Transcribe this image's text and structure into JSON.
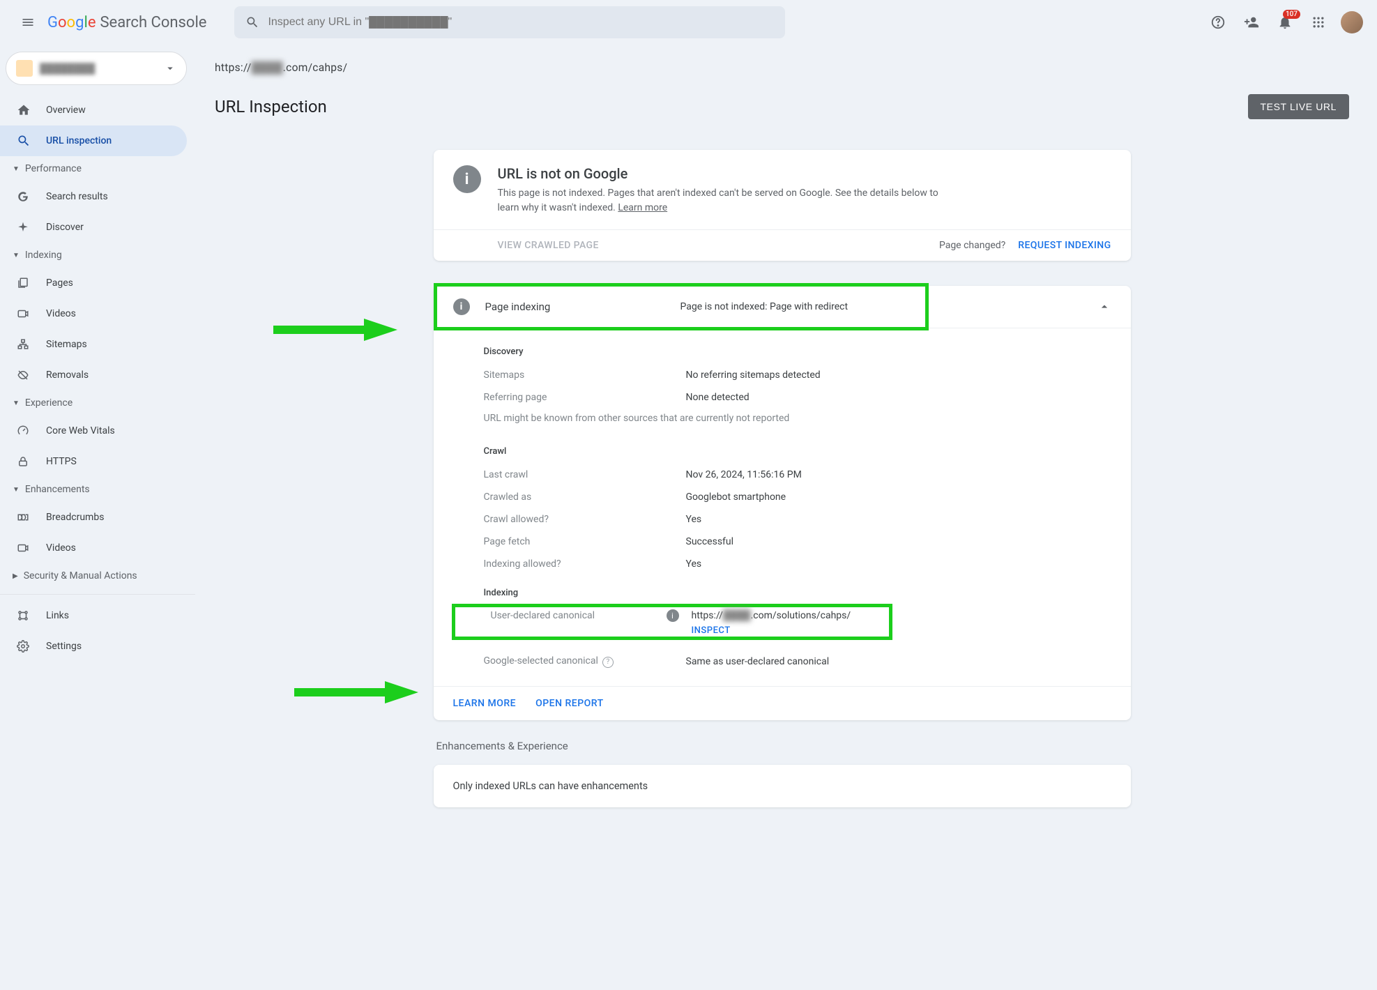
{
  "brand": {
    "suffix": "Search Console"
  },
  "search": {
    "placeholder": "Inspect any URL in \"██████████\""
  },
  "header": {
    "badge": "107"
  },
  "sidebar": {
    "property": "████████",
    "items": {
      "overview": "Overview",
      "url_inspection": "URL inspection"
    },
    "sections": {
      "performance": {
        "label": "Performance",
        "items": {
          "search_results": "Search results",
          "discover": "Discover"
        }
      },
      "indexing": {
        "label": "Indexing",
        "items": {
          "pages": "Pages",
          "videos": "Videos",
          "sitemaps": "Sitemaps",
          "removals": "Removals"
        }
      },
      "experience": {
        "label": "Experience",
        "items": {
          "cwv": "Core Web Vitals",
          "https": "HTTPS"
        }
      },
      "enhancements": {
        "label": "Enhancements",
        "items": {
          "breadcrumbs": "Breadcrumbs",
          "videos": "Videos"
        }
      },
      "security": {
        "label": "Security & Manual Actions"
      }
    },
    "footer": {
      "links": "Links",
      "settings": "Settings"
    }
  },
  "main": {
    "url_prefix": "https://",
    "url_blur": "████",
    "url_suffix": ".com/cahps/",
    "title": "URL Inspection",
    "test_btn": "TEST LIVE URL",
    "status": {
      "title": "URL is not on Google",
      "desc": "This page is not indexed. Pages that aren't indexed can't be served on Google. See the details below to learn why it wasn't indexed.",
      "learn_more": "Learn more"
    },
    "actions": {
      "view_crawled": "VIEW CRAWLED PAGE",
      "page_changed": "Page changed?",
      "request_indexing": "REQUEST INDEXING"
    },
    "page_indexing": {
      "title": "Page indexing",
      "value": "Page is not indexed: Page with redirect",
      "discovery": {
        "label": "Discovery",
        "sitemaps_k": "Sitemaps",
        "sitemaps_v": "No referring sitemaps detected",
        "ref_k": "Referring page",
        "ref_v": "None detected",
        "note": "URL might be known from other sources that are currently not reported"
      },
      "crawl": {
        "label": "Crawl",
        "last_k": "Last crawl",
        "last_v": "Nov 26, 2024, 11:56:16 PM",
        "as_k": "Crawled as",
        "as_v": "Googlebot smartphone",
        "allowed_k": "Crawl allowed?",
        "allowed_v": "Yes",
        "fetch_k": "Page fetch",
        "fetch_v": "Successful",
        "idx_k": "Indexing allowed?",
        "idx_v": "Yes"
      },
      "indexing": {
        "label": "Indexing",
        "user_k": "User-declared canonical",
        "user_v_pre": "https://",
        "user_v_blur": "████",
        "user_v_post": ".com/solutions/cahps/",
        "inspect": "INSPECT",
        "google_k": "Google-selected canonical",
        "google_v": "Same as user-declared canonical"
      }
    },
    "footer": {
      "learn_more": "LEARN MORE",
      "open_report": "OPEN REPORT"
    },
    "enh": {
      "header": "Enhancements & Experience",
      "msg": "Only indexed URLs can have enhancements"
    }
  }
}
